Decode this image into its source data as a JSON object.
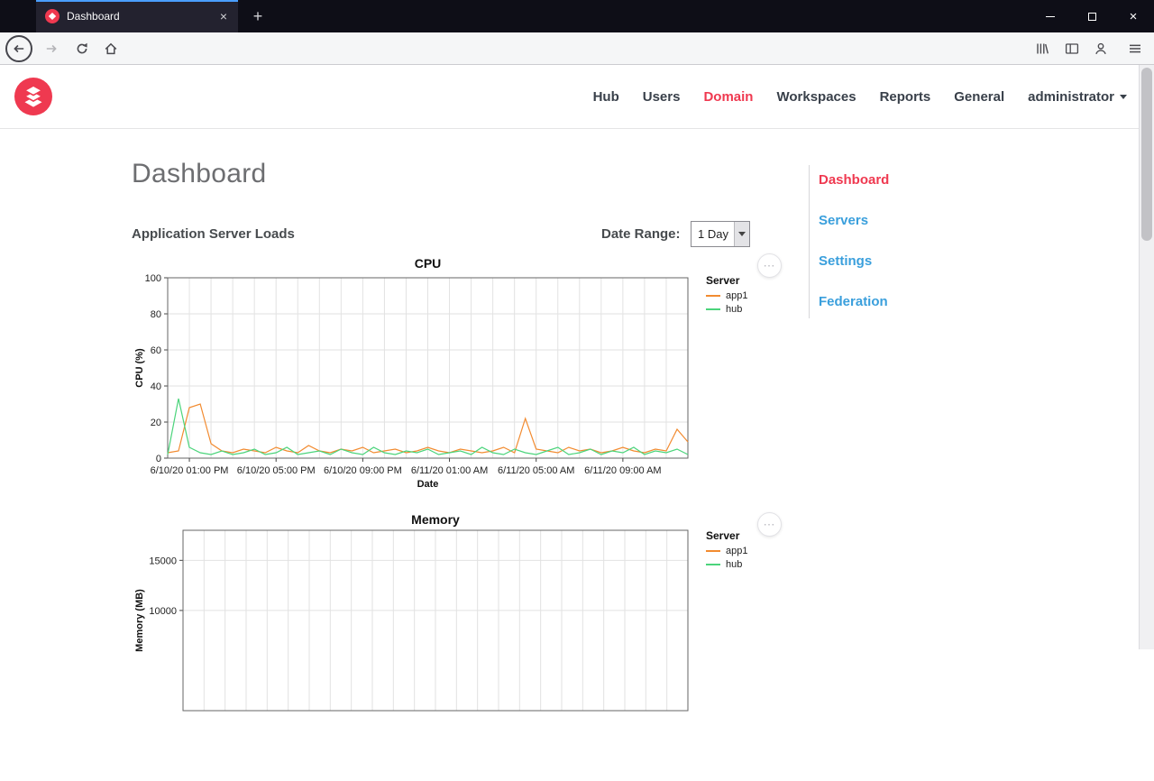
{
  "browser": {
    "tab_title": "Dashboard",
    "url": "https://test.turbo.net/admin/domain/"
  },
  "icons": {
    "close": "×",
    "plus": "+",
    "ellipsis": "⋯"
  },
  "site_nav": {
    "items": [
      {
        "label": "Hub",
        "active": false
      },
      {
        "label": "Users",
        "active": false
      },
      {
        "label": "Domain",
        "active": true
      },
      {
        "label": "Workspaces",
        "active": false
      },
      {
        "label": "Reports",
        "active": false
      },
      {
        "label": "General",
        "active": false
      }
    ],
    "user_menu": "administrator"
  },
  "page": {
    "title": "Dashboard",
    "section_title": "Application Server Loads",
    "date_range_label": "Date Range:",
    "date_range_value": "1 Day"
  },
  "side_nav": {
    "items": [
      {
        "label": "Dashboard",
        "active": true
      },
      {
        "label": "Servers",
        "active": false
      },
      {
        "label": "Settings",
        "active": false
      },
      {
        "label": "Federation",
        "active": false
      }
    ]
  },
  "colors": {
    "accent_red": "#ef3950",
    "link_blue": "#3a9fdc",
    "series_app1": "#f28b30",
    "series_hub": "#4bd47b"
  },
  "chart_data": [
    {
      "type": "line",
      "title": "CPU",
      "xlabel": "Date",
      "ylabel": "CPU (%)",
      "ylim": [
        0,
        100
      ],
      "yticks": [
        0,
        20,
        40,
        60,
        80,
        100
      ],
      "x_range_hours": [
        0,
        24
      ],
      "x_tick_positions_hours": [
        1,
        5,
        9,
        13,
        17,
        21
      ],
      "x_tick_labels": [
        "6/10/20 01:00 PM",
        "6/10/20 05:00 PM",
        "6/10/20 09:00 PM",
        "6/11/20 01:00 AM",
        "6/11/20 05:00 AM",
        "6/11/20 09:00 AM"
      ],
      "grid": true,
      "legend_title": "Server",
      "legend_position": "right",
      "series": [
        {
          "name": "app1",
          "color": "#f28b30",
          "values": [
            3,
            4,
            28,
            30,
            8,
            4,
            3,
            5,
            4,
            3,
            6,
            4,
            3,
            7,
            4,
            3,
            5,
            4,
            6,
            3,
            4,
            5,
            3,
            4,
            6,
            4,
            3,
            5,
            4,
            3,
            4,
            6,
            3,
            22,
            5,
            4,
            3,
            6,
            4,
            5,
            3,
            4,
            6,
            4,
            3,
            5,
            4,
            16,
            9
          ]
        },
        {
          "name": "hub",
          "color": "#4bd47b",
          "values": [
            2,
            33,
            6,
            3,
            2,
            4,
            2,
            3,
            5,
            2,
            3,
            6,
            2,
            3,
            4,
            2,
            5,
            3,
            2,
            6,
            3,
            2,
            4,
            3,
            5,
            2,
            3,
            4,
            2,
            6,
            3,
            2,
            5,
            3,
            2,
            4,
            6,
            2,
            3,
            5,
            2,
            4,
            3,
            6,
            2,
            4,
            3,
            5,
            2
          ]
        }
      ]
    },
    {
      "type": "line",
      "title": "Memory",
      "xlabel": "",
      "ylabel": "Memory (MB)",
      "ylim": [
        0,
        18000
      ],
      "yticks": [
        10000,
        15000
      ],
      "x_range_hours": [
        0,
        24
      ],
      "x_tick_positions_hours": [],
      "x_tick_labels": [],
      "grid": true,
      "legend_title": "Server",
      "legend_position": "right",
      "series": [
        {
          "name": "app1",
          "color": "#f28b30",
          "values": []
        },
        {
          "name": "hub",
          "color": "#4bd47b",
          "values": []
        }
      ]
    }
  ]
}
